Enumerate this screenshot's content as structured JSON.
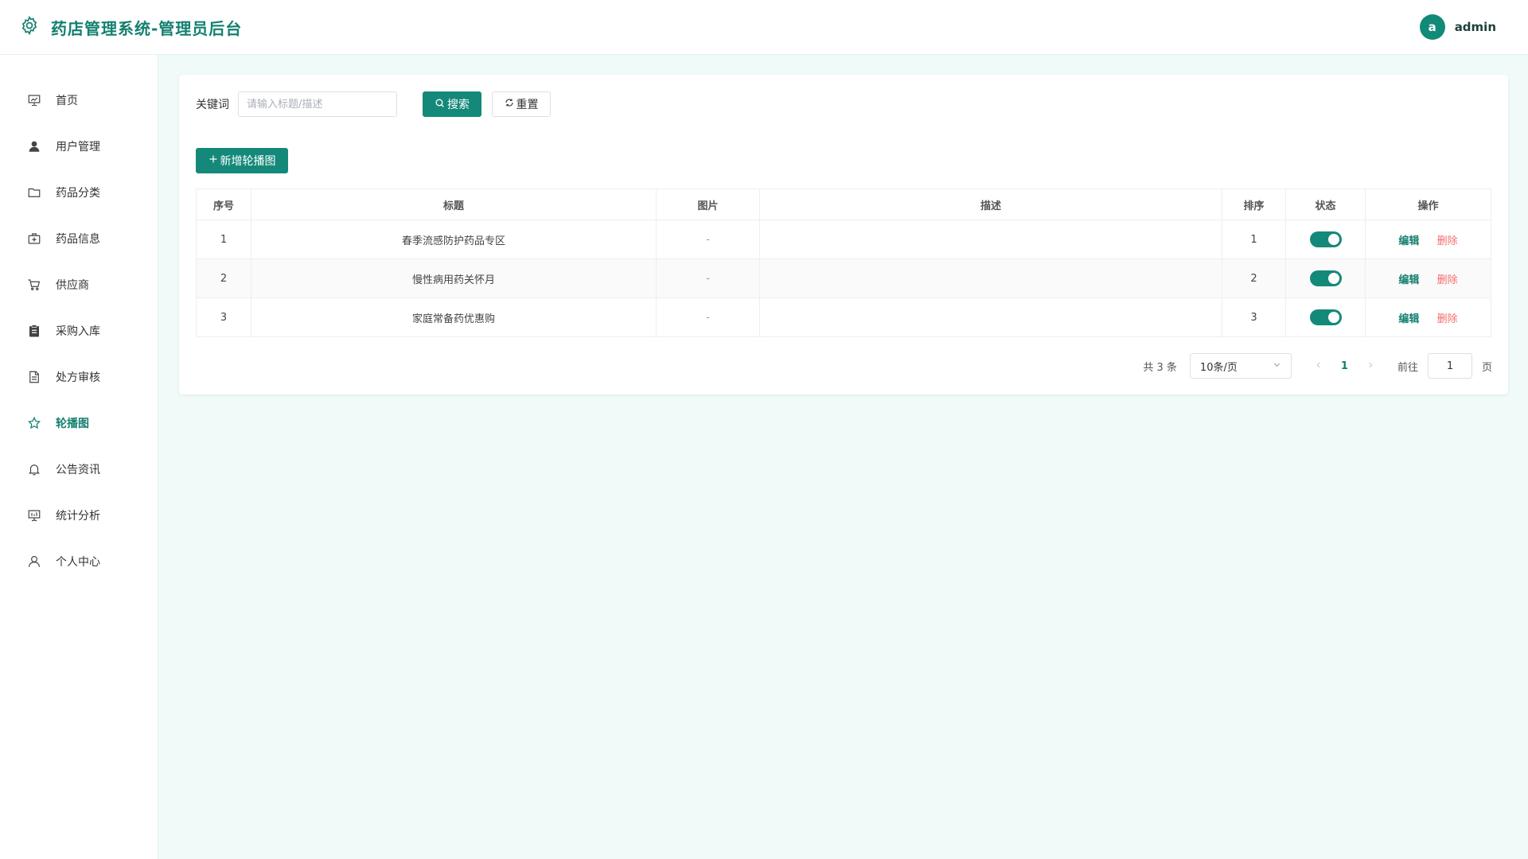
{
  "header": {
    "title": "药店管理系统-管理员后台",
    "avatar_letter": "a",
    "username": "admin"
  },
  "colors": {
    "primary": "#14897a",
    "danger": "#f56c6c",
    "background": "#f0fbf9"
  },
  "sidebar": {
    "items": [
      {
        "label": "首页",
        "icon": "presentation-icon"
      },
      {
        "label": "用户管理",
        "icon": "user-filled-icon"
      },
      {
        "label": "药品分类",
        "icon": "folder-icon"
      },
      {
        "label": "药品信息",
        "icon": "first-aid-kit-icon"
      },
      {
        "label": "供应商",
        "icon": "shopping-cart-icon"
      },
      {
        "label": "采购入库",
        "icon": "clipboard-icon"
      },
      {
        "label": "处方审核",
        "icon": "document-icon"
      },
      {
        "label": "轮播图",
        "icon": "star-icon",
        "active": true
      },
      {
        "label": "公告资讯",
        "icon": "bell-icon"
      },
      {
        "label": "统计分析",
        "icon": "data-board-icon"
      },
      {
        "label": "个人中心",
        "icon": "user-icon"
      }
    ]
  },
  "search": {
    "label": "关键词",
    "placeholder": "请输入标题/描述",
    "value": "",
    "search_label": "搜索",
    "reset_label": "重置"
  },
  "toolbar": {
    "add_label": "新增轮播图"
  },
  "table": {
    "columns": [
      "序号",
      "标题",
      "图片",
      "描述",
      "排序",
      "状态",
      "操作"
    ],
    "rows": [
      {
        "index": "1",
        "title": "春季流感防护药品专区",
        "image": "-",
        "description": "",
        "sort": "1",
        "status": true
      },
      {
        "index": "2",
        "title": "慢性病用药关怀月",
        "image": "-",
        "description": "",
        "sort": "2",
        "status": true
      },
      {
        "index": "3",
        "title": "家庭常备药优惠购",
        "image": "-",
        "description": "",
        "sort": "3",
        "status": true
      }
    ],
    "edit_label": "编辑",
    "delete_label": "删除"
  },
  "pagination": {
    "total_text": "共 3 条",
    "page_size": "10条/页",
    "current_page": "1",
    "goto_label": "前往",
    "goto_value": "1",
    "goto_suffix": "页"
  }
}
